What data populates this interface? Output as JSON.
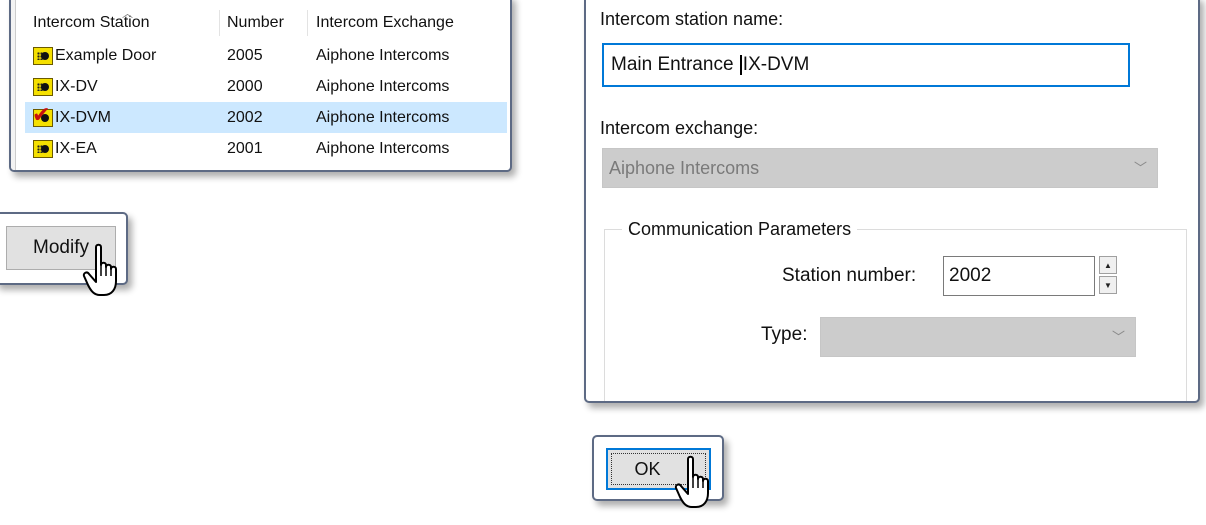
{
  "station_list": {
    "columns": [
      "Intercom Station",
      "Number",
      "Intercom Exchange"
    ],
    "rows": [
      {
        "name": "Example Door",
        "number": "2005",
        "exchange": "Aiphone Intercoms"
      },
      {
        "name": "IX-DV",
        "number": "2000",
        "exchange": "Aiphone Intercoms"
      },
      {
        "name": "IX-DVM",
        "number": "2002",
        "exchange": "Aiphone Intercoms"
      },
      {
        "name": "IX-EA",
        "number": "2001",
        "exchange": "Aiphone Intercoms"
      }
    ],
    "selected_row": "IX-DVM"
  },
  "modify_button": {
    "label": "Modify"
  },
  "dialog": {
    "station_name_label": "Intercom station name:",
    "station_name_value_before": "Main Entrance ",
    "station_name_value_after": "IX-DVM",
    "exchange_label": "Intercom exchange:",
    "exchange_value": "Aiphone Intercoms",
    "comm_params_legend": "Communication Parameters",
    "station_number_label": "Station number:",
    "station_number_value": "2002",
    "type_label": "Type:",
    "type_value": ""
  },
  "ok_button": {
    "label": "OK"
  },
  "colors": {
    "callout_border": "#5d6a84",
    "selected_row": "#cce8ff",
    "focus_border": "#0078d7",
    "disabled_field": "#cccccc",
    "station_icon": "#f5e000",
    "check_mark": "#c81010"
  },
  "icons": {
    "station": "intercom-station-icon",
    "selected_station": "intercom-station-checked-icon",
    "cursor": "hand-pointer-cursor-icon",
    "sort": "sort-ascending-icon",
    "dropdown": "chevron-down-icon",
    "spin_up": "spin-up-icon",
    "spin_down": "spin-down-icon"
  }
}
